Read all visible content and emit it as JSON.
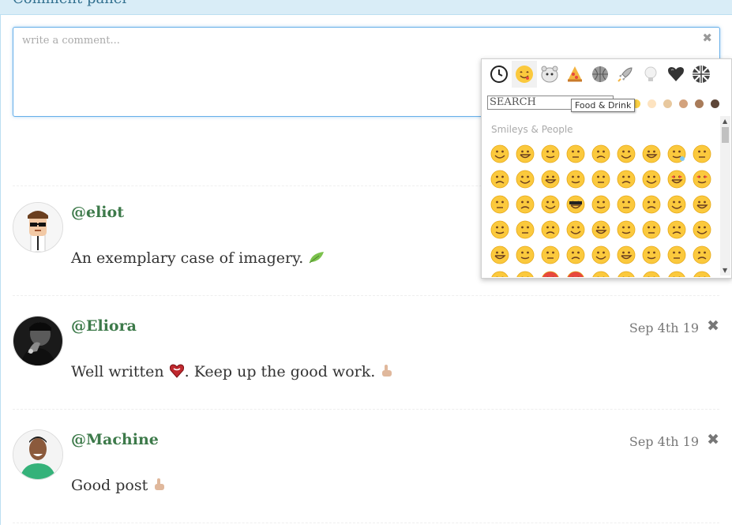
{
  "panel": {
    "title": "Comment panel"
  },
  "composer": {
    "placeholder": "write a comment...",
    "clear_icon": "✖"
  },
  "comments": [
    {
      "username": "@eliot",
      "text": "An exemplary case of imagery.",
      "emoji": "leaf",
      "date": "",
      "avatar": "cartoon-man-with-sunglasses"
    },
    {
      "username": "@Eliora",
      "text_before": "Well written ",
      "emoji_heart": "heart",
      "text_after": ". Keep up the good work.",
      "emoji": "pointing-hand",
      "date": "Sep 4th 19",
      "delete_icon": "✖",
      "avatar": "man-with-hand-on-chin-bw"
    },
    {
      "username": "@Machine",
      "text": "Good post",
      "emoji": "pointing-hand",
      "date": "Sep 4th 19",
      "delete_icon": "✖",
      "avatar": "smiling-man-green-shirt"
    }
  ],
  "emoji_picker": {
    "tabs": [
      {
        "name": "recent",
        "icon": "clock-icon",
        "active": false
      },
      {
        "name": "smileys",
        "icon": "smiley-icon",
        "active": true
      },
      {
        "name": "animals",
        "icon": "hamster-icon",
        "active": false
      },
      {
        "name": "food",
        "icon": "pizza-icon",
        "active": false
      },
      {
        "name": "activity",
        "icon": "basketball-icon",
        "active": false
      },
      {
        "name": "travel",
        "icon": "rocket-icon",
        "active": false
      },
      {
        "name": "objects",
        "icon": "lightbulb-icon",
        "active": false
      },
      {
        "name": "symbols",
        "icon": "heart-icon",
        "active": false
      },
      {
        "name": "flags",
        "icon": "flag-icon",
        "active": false
      }
    ],
    "search_placeholder": "SEARCH",
    "tooltip": "Food & Drink",
    "skin_tones": [
      "#fbd043",
      "#fde3c0",
      "#e8c89e",
      "#d3a27d",
      "#a97c5a",
      "#5e4638"
    ],
    "category_label": "Smileys & People",
    "colors": {
      "face": "#fbc93d",
      "face_edge": "#e6a817",
      "red": "#e7483e",
      "accent": "#3d7a4a"
    }
  }
}
